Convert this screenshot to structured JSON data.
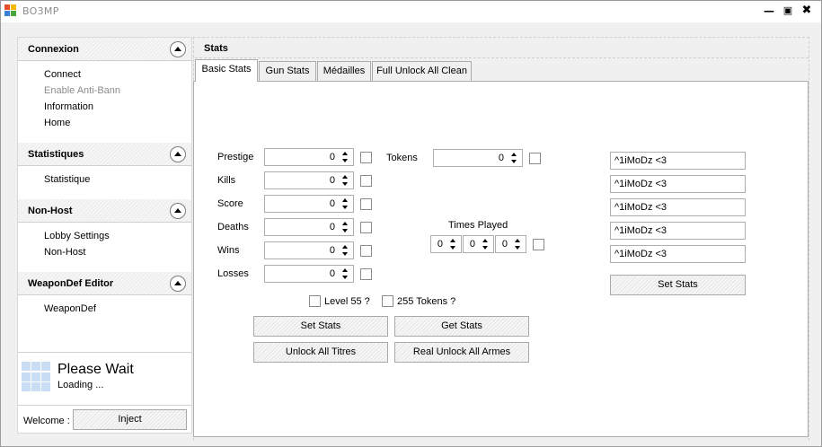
{
  "window": {
    "title": "BO3MP"
  },
  "sidebar": {
    "sections": [
      {
        "title": "Connexion",
        "items": [
          {
            "label": "Connect",
            "enabled": true
          },
          {
            "label": "Enable Anti-Bann",
            "enabled": false
          },
          {
            "label": "Information",
            "enabled": true
          },
          {
            "label": "Home",
            "enabled": true
          }
        ]
      },
      {
        "title": "Statistiques",
        "items": [
          {
            "label": "Statistique",
            "enabled": true
          }
        ]
      },
      {
        "title": "Non-Host",
        "items": [
          {
            "label": "Lobby Settings",
            "enabled": true
          },
          {
            "label": "Non-Host",
            "enabled": true
          }
        ]
      },
      {
        "title": "WeaponDef Editor",
        "items": [
          {
            "label": "WeaponDef",
            "enabled": true
          }
        ]
      }
    ],
    "status": {
      "title": "Please Wait",
      "subtitle": "Loading ..."
    },
    "welcome_label": "Welcome :",
    "inject_button": "Inject"
  },
  "main": {
    "title": "Stats",
    "tabs": [
      "Basic Stats",
      "Gun Stats",
      "Médailles",
      "Full Unlock All Clean"
    ],
    "active_tab": "Basic Stats",
    "fields": [
      {
        "label": "Prestige",
        "value": "0"
      },
      {
        "label": "Kills",
        "value": "0"
      },
      {
        "label": "Score",
        "value": "0"
      },
      {
        "label": "Deaths",
        "value": "0"
      },
      {
        "label": "Wins",
        "value": "0"
      },
      {
        "label": "Losses",
        "value": "0"
      }
    ],
    "tokens": {
      "label": "Tokens",
      "value": "0"
    },
    "times_played": {
      "label": "Times Played",
      "values": [
        "0",
        "0",
        "0"
      ]
    },
    "level55_label": "Level 55 ?",
    "tokens255_label": "255 Tokens ?",
    "buttons": {
      "set_stats": "Set Stats",
      "get_stats": "Get Stats",
      "unlock_titres": "Unlock All Titres",
      "unlock_armes": "Real Unlock All Armes"
    },
    "names": [
      "^1iMoDz <3",
      "^1iMoDz <3",
      "^1iMoDz <3",
      "^1iMoDz <3",
      "^1iMoDz <3"
    ],
    "names_set_button": "Set Stats"
  }
}
